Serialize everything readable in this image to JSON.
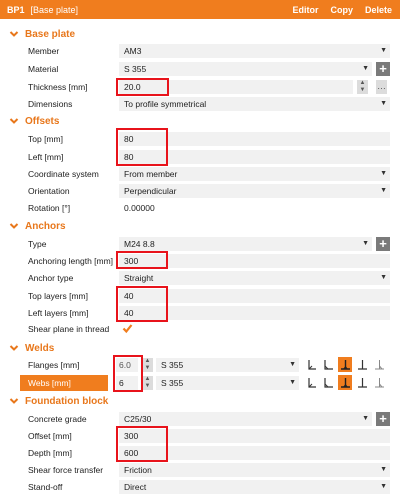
{
  "header": {
    "id": "BP1",
    "subtitle": "[Base plate]",
    "editor": "Editor",
    "copy": "Copy",
    "delete": "Delete"
  },
  "sections": {
    "base_plate": "Base plate",
    "offsets": "Offsets",
    "anchors": "Anchors",
    "welds": "Welds",
    "foundation": "Foundation block"
  },
  "base_plate": {
    "member_label": "Member",
    "member_value": "AM3",
    "material_label": "Material",
    "material_value": "S 355",
    "thickness_label": "Thickness [mm]",
    "thickness_value": "20.0",
    "dimensions_label": "Dimensions",
    "dimensions_value": "To profile symmetrical"
  },
  "offsets": {
    "top_label": "Top [mm]",
    "top_value": "80",
    "left_label": "Left [mm]",
    "left_value": "80",
    "coord_label": "Coordinate system",
    "coord_value": "From member",
    "orient_label": "Orientation",
    "orient_value": "Perpendicular",
    "rot_label": "Rotation [°]",
    "rot_value": "0.00000"
  },
  "anchors": {
    "type_label": "Type",
    "type_value": "M24 8.8",
    "length_label": "Anchoring length [mm]",
    "length_value": "300",
    "atype_label": "Anchor type",
    "atype_value": "Straight",
    "top_layers_label": "Top layers [mm]",
    "top_layers_value": "40",
    "left_layers_label": "Left layers [mm]",
    "left_layers_value": "40",
    "shear_label": "Shear plane in thread",
    "shear_checked": true
  },
  "welds": {
    "flanges_label": "Flanges [mm]",
    "flanges_value": "6.0",
    "flanges_material": "S 355",
    "webs_label": "Webs [mm]",
    "webs_value": "6",
    "webs_material": "S 355"
  },
  "foundation": {
    "grade_label": "Concrete grade",
    "grade_value": "C25/30",
    "offset_label": "Offset [mm]",
    "offset_value": "300",
    "depth_label": "Depth [mm]",
    "depth_value": "600",
    "shear_label": "Shear force transfer",
    "shear_value": "Friction",
    "standoff_label": "Stand-off",
    "standoff_value": "Direct"
  },
  "colors": {
    "accent": "#f07d1e",
    "highlight": "#e8131b",
    "field_bg": "#f1f1f1"
  },
  "icons": {
    "section": "chevron-down-icon",
    "dropdown": "triangle-down-icon",
    "add": "plus-icon",
    "weld": "weld-type-icon"
  }
}
